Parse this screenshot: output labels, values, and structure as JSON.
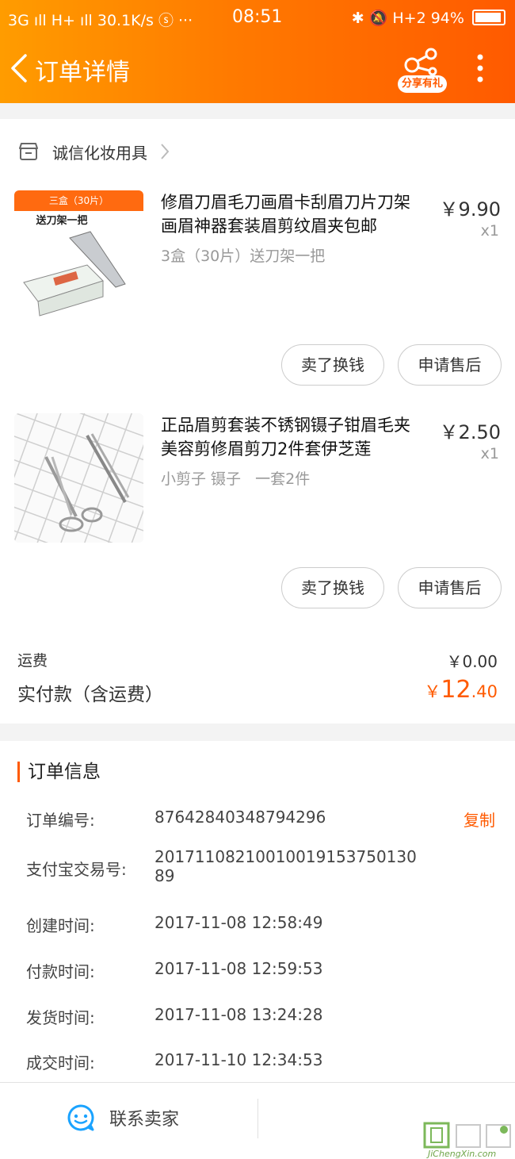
{
  "status_bar": {
    "left": "3G ıll H+ ıll 30.1K/s ⓢ ···",
    "time": "08:51",
    "right": "H+2 94%"
  },
  "header": {
    "title": "订单详情",
    "share_label": "分享有礼"
  },
  "shop": {
    "name": "诚信化妆用具"
  },
  "items": [
    {
      "title": "修眉刀眉毛刀画眉卡刮眉刀片刀架画眉神器套装眉剪纹眉夹包邮",
      "spec": "3盒（30片）送刀架一把",
      "price": "￥9.90",
      "qty": "x1",
      "thumb_banner": "三盒（30片）",
      "thumb_text": "送刀架一把",
      "sell_label": "卖了换钱",
      "aftersale_label": "申请售后"
    },
    {
      "title": "正品眉剪套装不锈钢镊子钳眉毛夹美容剪修眉剪刀2件套伊芝莲",
      "spec": "小剪子 镊子   一套2件",
      "price": "￥2.50",
      "qty": "x1",
      "sell_label": "卖了换钱",
      "aftersale_label": "申请售后"
    }
  ],
  "summary": {
    "shipping_label": "运费",
    "shipping_value": "￥0.00",
    "total_label": "实付款（含运费）",
    "total_currency": "￥",
    "total_int": "12",
    "total_dec": ".40"
  },
  "order_info": {
    "title": "订单信息",
    "copy_label": "复制",
    "rows": [
      {
        "label": "订单编号:",
        "value": "87642840348794296"
      },
      {
        "label": "支付宝交易号:",
        "value": "2017110821001001915375013089"
      },
      {
        "label": "创建时间:",
        "value": "2017-11-08 12:58:49"
      },
      {
        "label": "付款时间:",
        "value": "2017-11-08 12:59:53"
      },
      {
        "label": "发货时间:",
        "value": "2017-11-08 13:24:28"
      },
      {
        "label": "成交时间:",
        "value": "2017-11-10 12:34:53"
      }
    ]
  },
  "bottom_bar": {
    "contact_label": "联系卖家"
  },
  "watermark": {
    "text": "JiChengXin.com"
  },
  "colors": {
    "accent": "#ff5a00",
    "header_start": "#ff9c00",
    "header_end": "#ff5a00"
  }
}
